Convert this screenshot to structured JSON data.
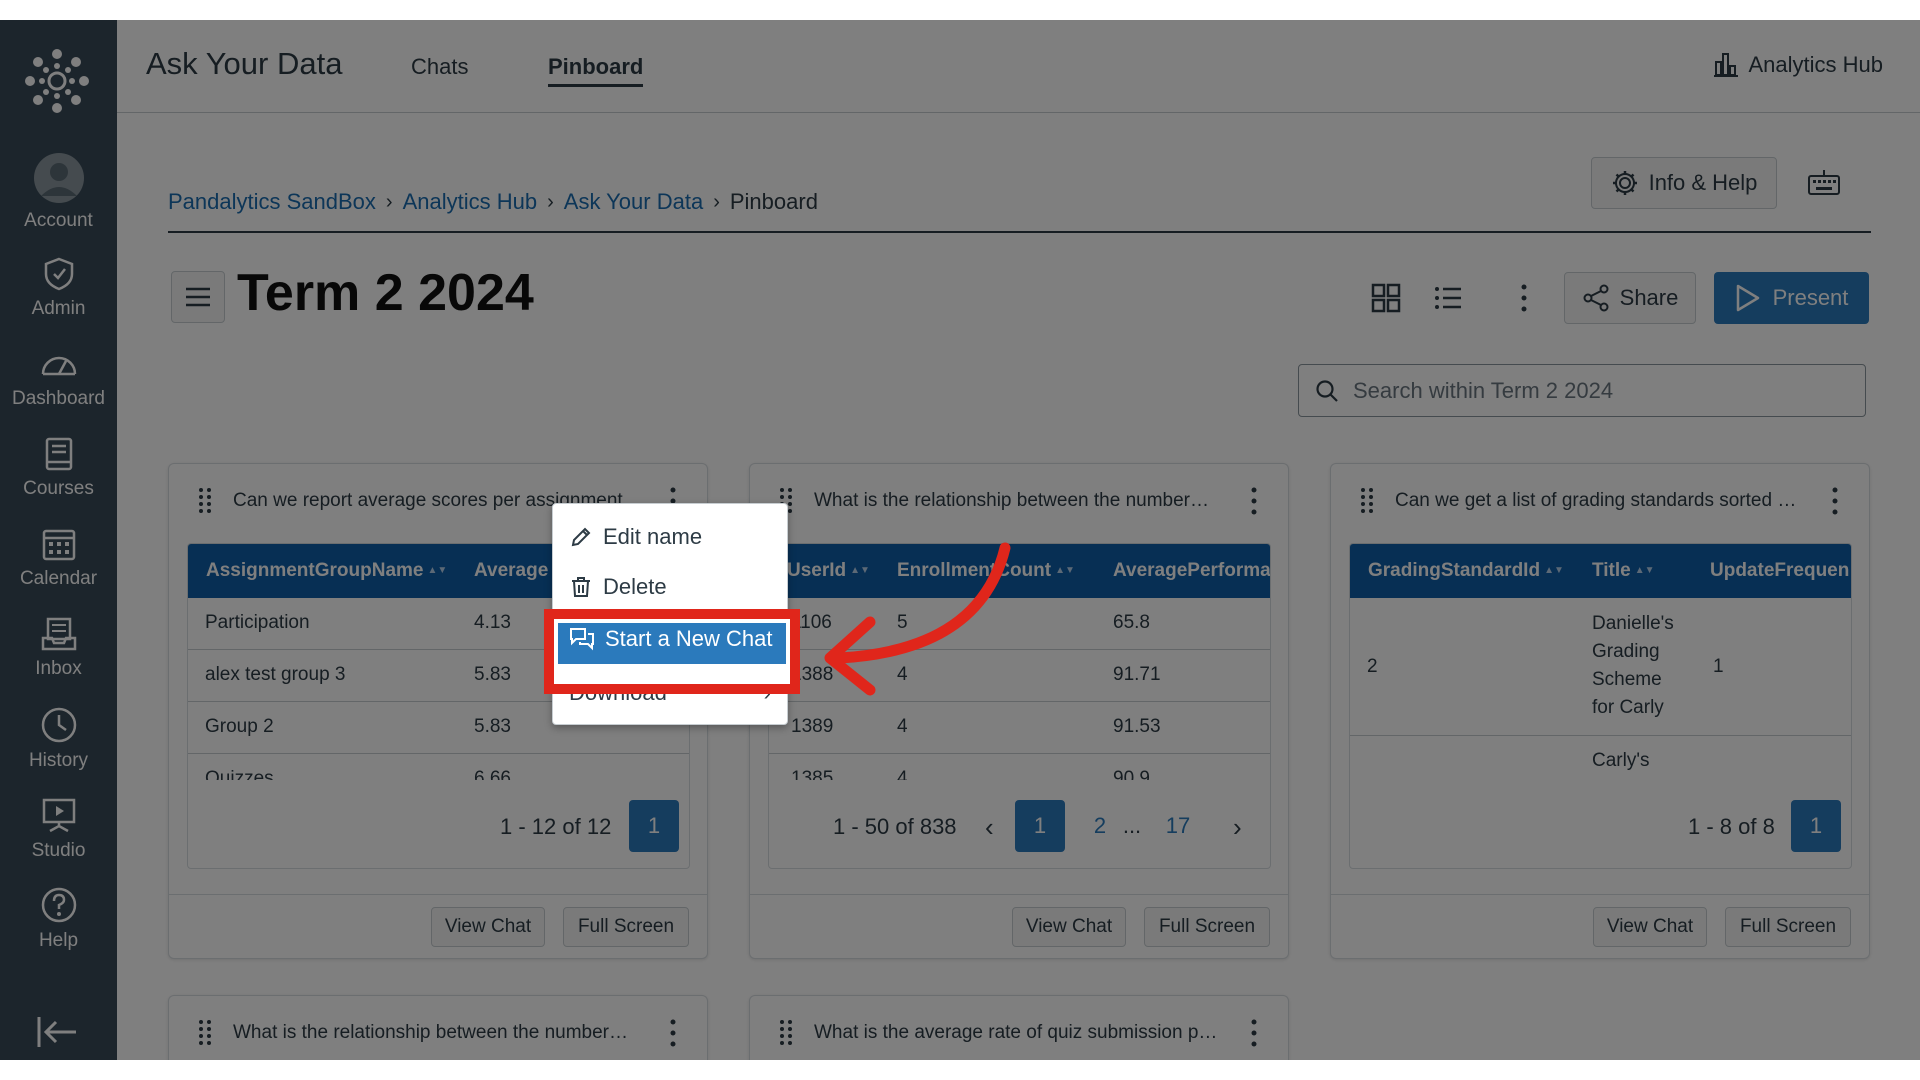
{
  "global_nav": {
    "items": [
      {
        "label": "Account",
        "icon": "account-icon"
      },
      {
        "label": "Admin",
        "icon": "admin-shield-icon"
      },
      {
        "label": "Dashboard",
        "icon": "dashboard-gauge-icon"
      },
      {
        "label": "Courses",
        "icon": "courses-book-icon"
      },
      {
        "label": "Calendar",
        "icon": "calendar-icon"
      },
      {
        "label": "Inbox",
        "icon": "inbox-icon"
      },
      {
        "label": "History",
        "icon": "history-clock-icon"
      },
      {
        "label": "Studio",
        "icon": "studio-icon"
      },
      {
        "label": "Help",
        "icon": "help-icon"
      }
    ]
  },
  "topbar": {
    "title": "Ask Your Data",
    "tabs": [
      {
        "label": "Chats",
        "active": false
      },
      {
        "label": "Pinboard",
        "active": true
      }
    ],
    "hub_link": "Analytics Hub"
  },
  "breadcrumb": {
    "links": [
      "Pandalytics SandBox",
      "Analytics Hub",
      "Ask Your Data"
    ],
    "current": "Pinboard"
  },
  "header": {
    "info_help": "Info & Help",
    "title": "Term 2 2024",
    "share": "Share",
    "present": "Present",
    "search_placeholder": "Search within Term 2 2024"
  },
  "cards": [
    {
      "title": "Can we report average scores per assignment…",
      "columns": [
        "AssignmentGroupName",
        "Average"
      ],
      "rows": [
        [
          "Participation",
          "4.13"
        ],
        [
          "alex test group 3",
          "5.83"
        ],
        [
          "Group 2",
          "5.83"
        ],
        [
          "Quizzes",
          "6.66"
        ]
      ],
      "pager_info": "1 - 12 of 12",
      "pages": [
        "1"
      ],
      "view_chat": "View Chat",
      "full_screen": "Full Screen"
    },
    {
      "title": "What is the relationship between the number…",
      "columns": [
        "UserId",
        "EnrollmentCount",
        "AveragePerforma"
      ],
      "rows": [
        [
          "1106",
          "5",
          "65.8"
        ],
        [
          "1388",
          "4",
          "91.71"
        ],
        [
          "1389",
          "4",
          "91.53"
        ],
        [
          "1385",
          "4",
          "90.9"
        ]
      ],
      "pager_info": "1 - 50 of 838",
      "pages": [
        "1",
        "2",
        "...",
        "17"
      ],
      "view_chat": "View Chat",
      "full_screen": "Full Screen"
    },
    {
      "title": "Can we get a list of grading standards sorted b…",
      "columns": [
        "GradingStandardId",
        "Title",
        "UpdateFrequen"
      ],
      "rows": [
        [
          "2",
          "Danielle's Grading Scheme for Carly",
          "1"
        ],
        [
          "",
          "Carly's",
          ""
        ]
      ],
      "pager_info": "1 - 8 of 8",
      "pages": [
        "1"
      ],
      "view_chat": "View Chat",
      "full_screen": "Full Screen"
    },
    {
      "title": "What is the relationship between the number…"
    },
    {
      "title": "What is the average rate of quiz submission p…"
    }
  ],
  "context_menu": {
    "items": [
      "Edit name",
      "Delete",
      "Start a New Chat",
      "Download"
    ],
    "selected": "Start a New Chat"
  },
  "colors": {
    "nav_bg": "#394b58",
    "accent": "#2b7abc",
    "table_header": "#0f5ea8",
    "highlight": "#e0261b"
  }
}
